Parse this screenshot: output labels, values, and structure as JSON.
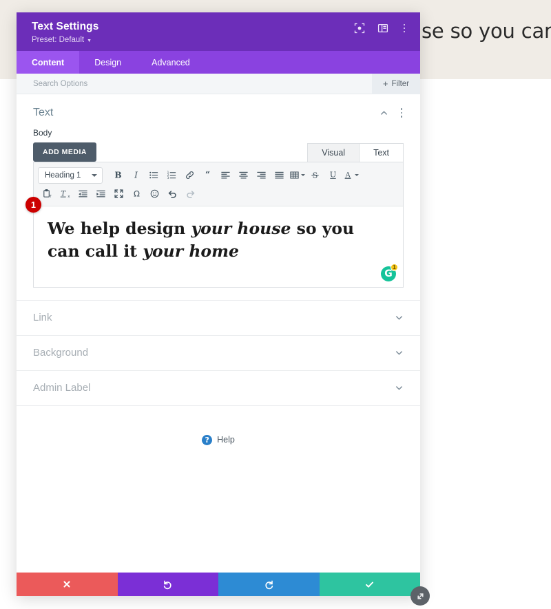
{
  "background": {
    "headline_fragment": "se so you can cal",
    "band_color": "#f0ece6"
  },
  "modal": {
    "title": "Text Settings",
    "preset_label": "Preset: Default",
    "header_icons": [
      {
        "name": "focus-target-icon"
      },
      {
        "name": "layout-columns-icon"
      },
      {
        "name": "overflow-menu-icon"
      }
    ],
    "tabs": [
      {
        "label": "Content",
        "active": true
      },
      {
        "label": "Design",
        "active": false
      },
      {
        "label": "Advanced",
        "active": false
      }
    ],
    "search": {
      "placeholder": "Search Options",
      "filter_label": "Filter",
      "filter_plus": "+"
    },
    "section": {
      "title": "Text",
      "field_label": "Body",
      "add_media_label": "ADD MEDIA",
      "editor_tabs": [
        {
          "label": "Visual",
          "active": true
        },
        {
          "label": "Text",
          "active": false
        }
      ],
      "format_select_value": "Heading 1",
      "step_badge": "1",
      "grammarly_letter": "G",
      "grammarly_count": "1",
      "content": {
        "line1_a": "We help design ",
        "line1_em": "your house",
        "line1_b": " so you",
        "line2_a": "can call it ",
        "line2_em": "your home"
      }
    },
    "accordions": [
      {
        "label": "Link"
      },
      {
        "label": "Background"
      },
      {
        "label": "Admin Label"
      }
    ],
    "help": {
      "label": "Help",
      "icon_glyph": "?"
    },
    "actions": [
      {
        "name": "cancel",
        "icon": "close-icon",
        "color": "#eb5a5a"
      },
      {
        "name": "undo",
        "icon": "undo-icon",
        "color": "#7b2fd6"
      },
      {
        "name": "redo",
        "icon": "redo-icon",
        "color": "#2d8bd4"
      },
      {
        "name": "save",
        "icon": "check-icon",
        "color": "#2ec4a0"
      }
    ]
  },
  "toolbar": {
    "row1": [
      "bold-icon",
      "italic-icon",
      "bulleted-list-icon",
      "numbered-list-icon",
      "link-icon",
      "blockquote-icon",
      "align-left-icon",
      "align-center-icon",
      "align-right-icon",
      "align-justify-icon",
      "table-icon",
      "strikethrough-icon",
      "underline-icon",
      "text-color-icon"
    ],
    "row2": [
      "paste-as-text-icon",
      "clear-formatting-icon",
      "outdent-icon",
      "indent-icon",
      "fullscreen-icon",
      "special-character-icon",
      "emoji-icon",
      "undo-icon",
      "redo-icon"
    ]
  }
}
